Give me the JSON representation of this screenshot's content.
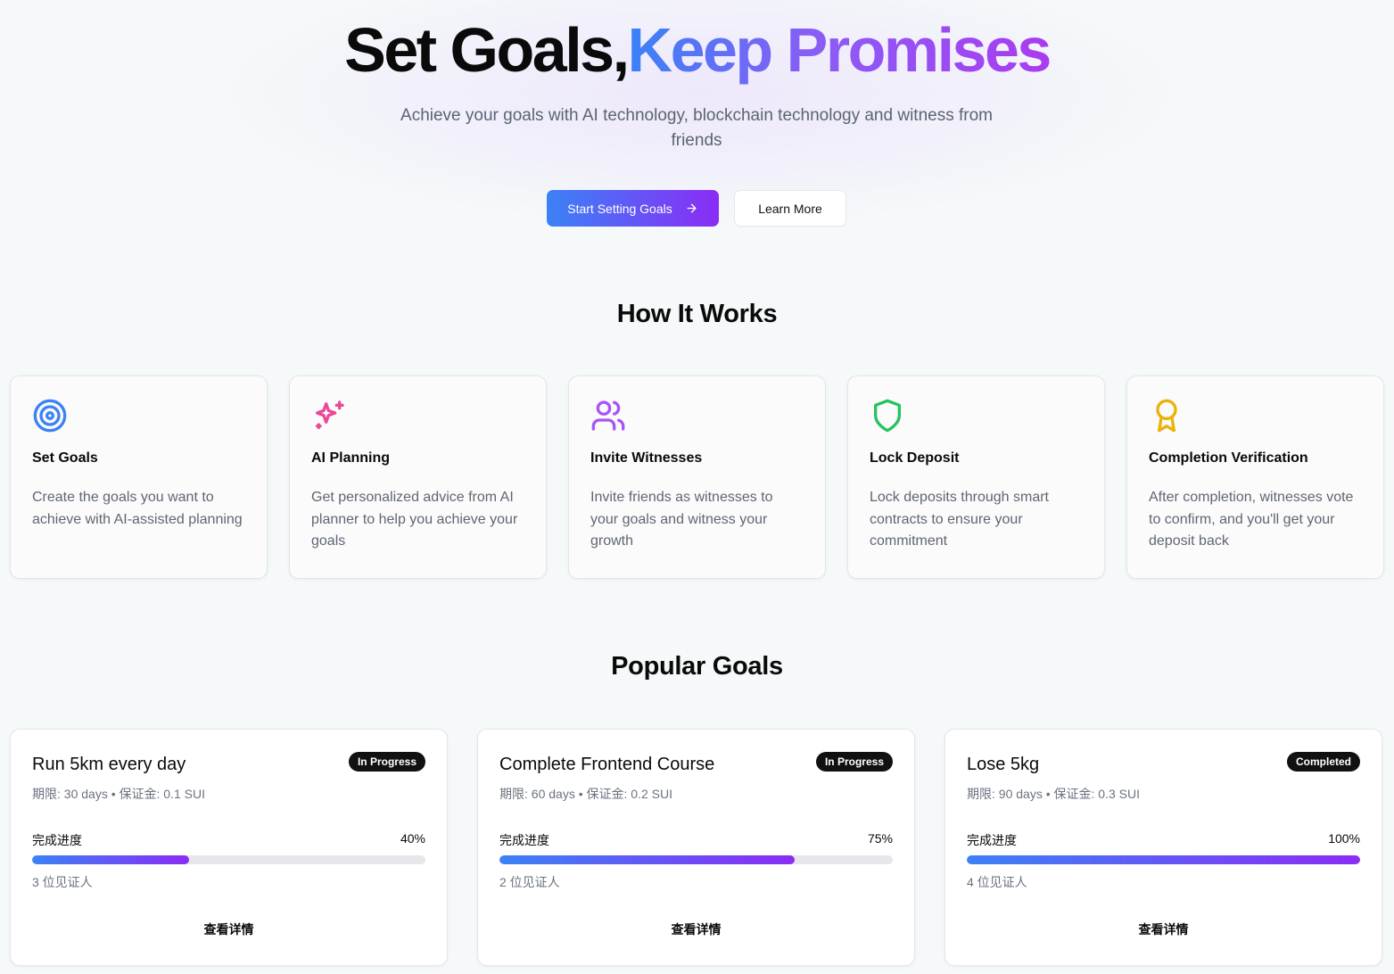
{
  "hero": {
    "title_plain": "Set Goals,",
    "title_accent": "Keep Promises",
    "subtitle": "Achieve your goals with AI technology, blockchain technology and witness from friends",
    "primary_button": "Start Setting Goals",
    "primary_button_icon": "arrow-right-icon",
    "secondary_button": "Learn More"
  },
  "how_it_works": {
    "title": "How It Works",
    "cards": [
      {
        "icon": "target-icon",
        "icon_color": "#3b82f6",
        "title": "Set Goals",
        "description": "Create the goals you want to achieve with AI-assisted planning"
      },
      {
        "icon": "sparkles-icon",
        "icon_color": "#ec4899",
        "title": "AI Planning",
        "description": "Get personalized advice from AI planner to help you achieve your goals"
      },
      {
        "icon": "users-icon",
        "icon_color": "#a855f7",
        "title": "Invite Witnesses",
        "description": "Invite friends as witnesses to your goals and witness your growth"
      },
      {
        "icon": "shield-icon",
        "icon_color": "#22c55e",
        "title": "Lock Deposit",
        "description": "Lock deposits through smart contracts to ensure your commitment"
      },
      {
        "icon": "award-icon",
        "icon_color": "#eab308",
        "title": "Completion Verification",
        "description": "After completion, witnesses vote to confirm, and you'll get your deposit back"
      }
    ]
  },
  "popular_goals": {
    "title": "Popular Goals",
    "goals": [
      {
        "title": "Run 5km every day",
        "status": "In Progress",
        "meta": "期限: 30 days • 保证金: 0.1 SUI",
        "progress_label": "完成进度",
        "progress_text": "40%",
        "progress": 40,
        "witnesses": "3 位见证人",
        "link": "查看详情"
      },
      {
        "title": "Complete Frontend Course",
        "status": "In Progress",
        "meta": "期限: 60 days • 保证金: 0.2 SUI",
        "progress_label": "完成进度",
        "progress_text": "75%",
        "progress": 75,
        "witnesses": "2 位见证人",
        "link": "查看详情"
      },
      {
        "title": "Lose 5kg",
        "status": "Completed",
        "meta": "期限: 90 days • 保证金: 0.3 SUI",
        "progress_label": "完成进度",
        "progress_text": "100%",
        "progress": 100,
        "witnesses": "4 位见证人",
        "link": "查看详情"
      }
    ]
  },
  "colors": {
    "accent_start": "#3b82f6",
    "accent_end": "#8b2cf5",
    "badge_bg": "#111111"
  }
}
